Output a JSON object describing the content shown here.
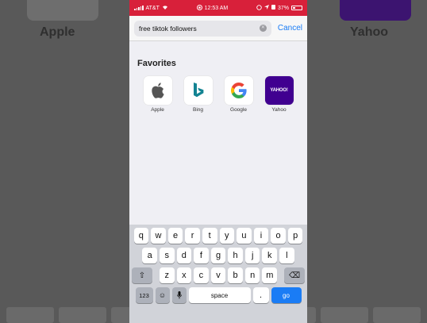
{
  "background": {
    "left_label": "Apple",
    "right_label": "Yahoo"
  },
  "status_bar": {
    "carrier": "AT&T",
    "time": "12:53 AM",
    "battery": "37%",
    "bar_color": "#d8203a"
  },
  "search": {
    "query": "free tiktok followers",
    "cancel_label": "Cancel"
  },
  "favorites": {
    "title": "Favorites",
    "items": [
      {
        "label": "Apple",
        "icon": "apple-logo-icon"
      },
      {
        "label": "Bing",
        "icon": "bing-logo-icon"
      },
      {
        "label": "Google",
        "icon": "google-logo-icon"
      },
      {
        "label": "Yahoo",
        "icon": "yahoo-logo-icon",
        "logo_text": "YAHOO!"
      }
    ]
  },
  "keyboard": {
    "row1": [
      "q",
      "w",
      "e",
      "r",
      "t",
      "y",
      "u",
      "i",
      "o",
      "p"
    ],
    "row2": [
      "a",
      "s",
      "d",
      "f",
      "g",
      "h",
      "j",
      "k",
      "l"
    ],
    "row3": [
      "z",
      "x",
      "c",
      "v",
      "b",
      "n",
      "m"
    ],
    "numbers_label": "123",
    "space_label": "space",
    "period_label": ".",
    "go_label": "go",
    "accent": "#1a7cf5"
  }
}
